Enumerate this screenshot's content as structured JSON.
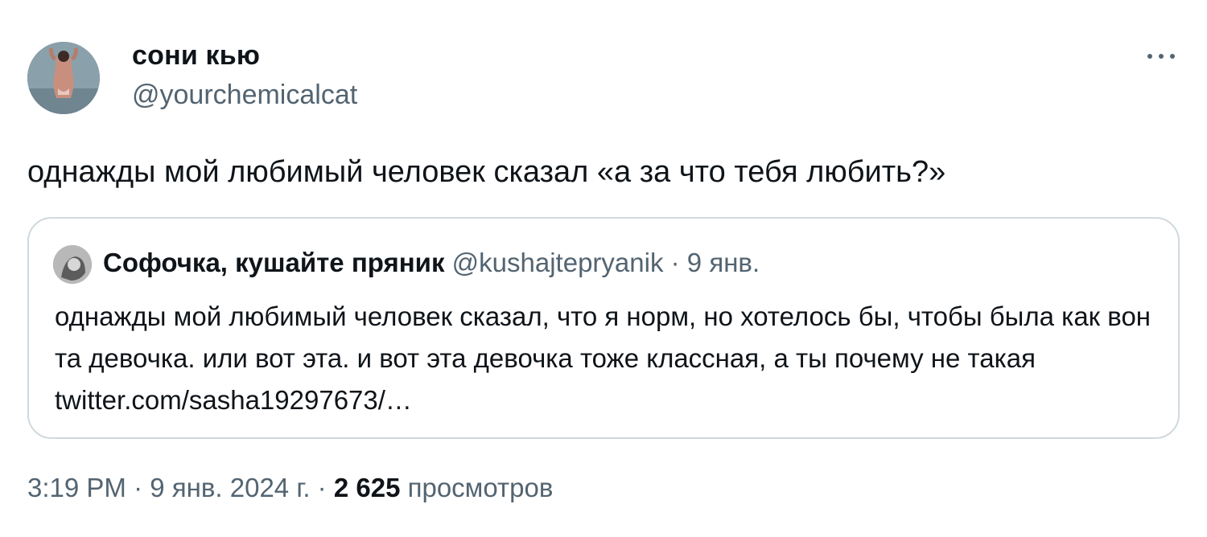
{
  "author": {
    "display_name": "сони кью",
    "handle": "@yourchemicalcat",
    "avatar_icon": "profile-photo"
  },
  "tweet": {
    "text": "однажды мой любимый человек сказал «а за что тебя любить?»"
  },
  "quote": {
    "display_name": "Софочка, кушайте пряник",
    "handle": "@kushajtepryanik",
    "separator": "·",
    "date": "9 янв.",
    "text": "однажды мой любимый человек сказал, что я норм, но хотелось бы, чтобы была как вон та девочка. или вот эта. и вот эта девочка тоже классная, а ты почему не такая twitter.com/sasha19297673/…"
  },
  "meta": {
    "time": "3:19 PM",
    "sep1": "·",
    "date": "9 янв. 2024 г.",
    "sep2": "·",
    "views_count": "2 625",
    "views_label": "просмотров"
  },
  "colors": {
    "text_primary": "#0f1419",
    "text_secondary": "#536471",
    "border": "#cfd9de"
  },
  "icons": {
    "more": "more-horizontal-icon"
  }
}
